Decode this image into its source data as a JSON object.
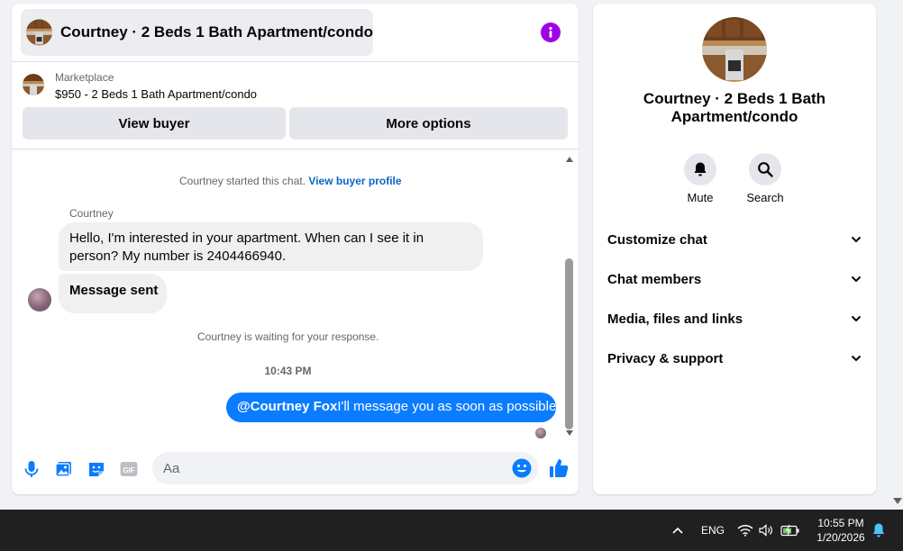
{
  "chat": {
    "title": "Courtney · 2 Beds 1 Bath Apartment/condo",
    "listing": {
      "source": "Marketplace",
      "price_title": "$950 - 2 Beds 1 Bath Apartment/condo"
    },
    "buttons": {
      "view_buyer": "View buyer",
      "more_options": "More options"
    },
    "messages": {
      "started_text": "Courtney started this chat.",
      "view_profile_link": "View buyer profile",
      "sender_name": "Courtney",
      "incoming_text": "Hello, I'm interested in your apartment. When can I see it in person? My number is 2404466940.",
      "sent_status": "Message sent",
      "waiting_text": "Courtney is waiting for your response.",
      "timestamp": "10:43 PM",
      "outgoing_mention": "@Courtney Fox",
      "outgoing_text": "I'll message you as soon as possible"
    },
    "composer": {
      "placeholder": "Aa",
      "icons": [
        "microphone-icon",
        "photo-icon",
        "sticker-icon",
        "gif-icon",
        "emoji-icon",
        "thumbs-up-icon"
      ]
    }
  },
  "info_panel": {
    "name": "Courtney · 2 Beds 1 Bath Apartment/condo",
    "actions": [
      {
        "label": "Mute",
        "icon": "bell-icon"
      },
      {
        "label": "Search",
        "icon": "search-icon"
      }
    ],
    "sections": [
      {
        "label": "Customize chat"
      },
      {
        "label": "Chat members"
      },
      {
        "label": "Media, files and links"
      },
      {
        "label": "Privacy & support"
      }
    ]
  },
  "taskbar": {
    "language": "ENG",
    "time": "10:55 PM",
    "date": "1/20/2026"
  },
  "colors": {
    "accent_blue": "#0a7cff",
    "info_purple": "#a100e6",
    "link_blue": "#0a66c2"
  }
}
